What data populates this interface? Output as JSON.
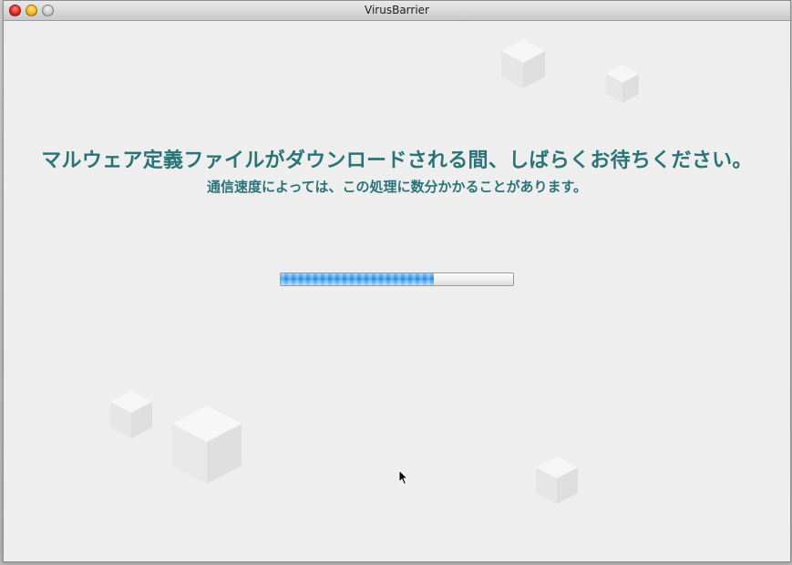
{
  "window": {
    "title": "VirusBarrier"
  },
  "message": {
    "headline": "マルウェア定義ファイルがダウンロードされる間、しばらくお待ちください。",
    "subline": "通信速度によっては、この処理に数分かかることがあります。"
  },
  "progress": {
    "fraction": 0.66
  },
  "icons": {
    "close": "close-button-icon",
    "minimize": "minimize-button-icon",
    "zoom": "zoom-button-icon",
    "cursor": "mouse-pointer-icon",
    "decoration": "cube-icon"
  },
  "colors": {
    "text_accent": "#2a7377",
    "progress_fill": "#2f8fe6",
    "window_bg": "#eeeeee"
  }
}
